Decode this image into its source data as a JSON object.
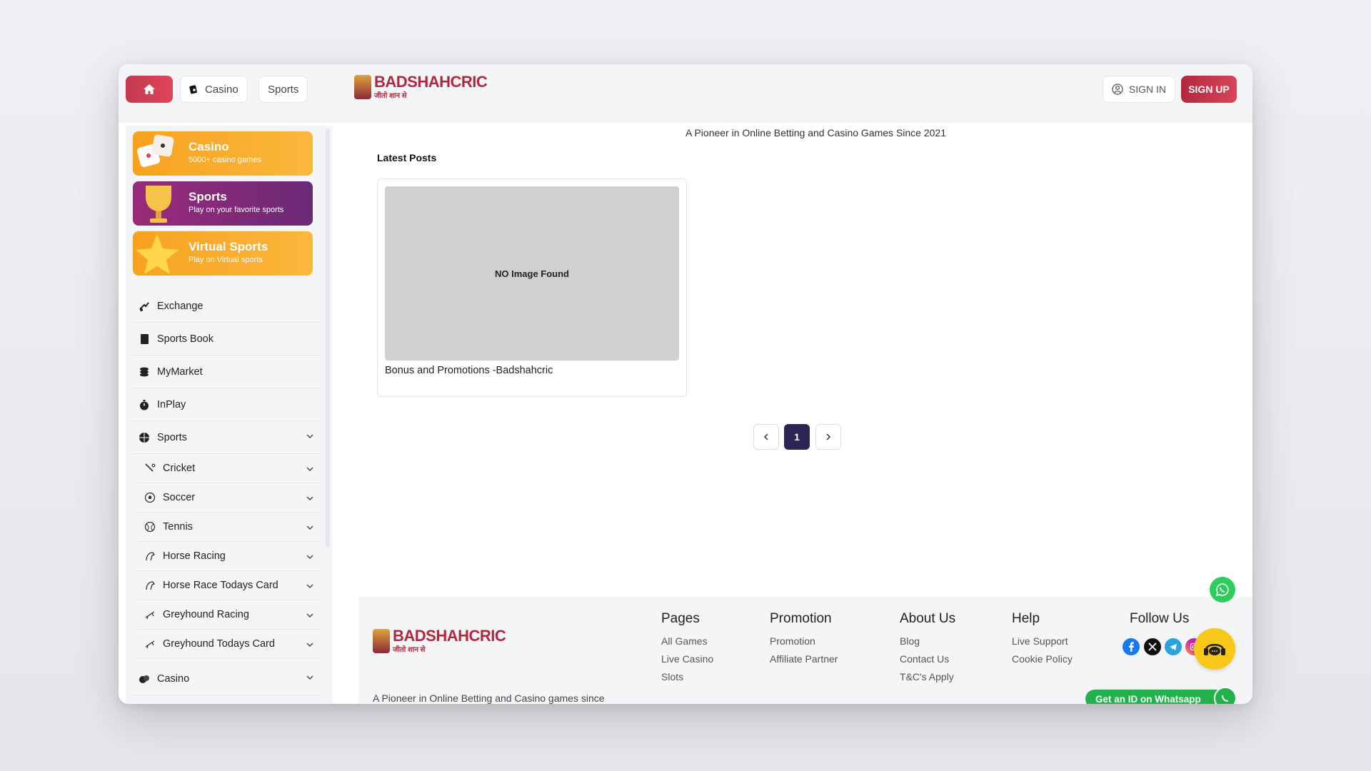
{
  "header": {
    "casino_label": "Casino",
    "sports_label": "Sports",
    "logo_text": "BADSHAHCRIC",
    "logo_tagline": "जीतो शान से",
    "signin_label": "SIGN IN",
    "signup_label": "SIGN UP",
    "accent": "#c8334a"
  },
  "sidebar": {
    "promos": [
      {
        "title": "Casino",
        "subtitle": "5000+ casino games",
        "color": "#f8a22a"
      },
      {
        "title": "Sports",
        "subtitle": "Play on your favorite sports",
        "color": "#8a2d78"
      },
      {
        "title": "Virtual Sports",
        "subtitle": "Play on Virtual sports",
        "color": "#f8a22a"
      }
    ],
    "items": [
      {
        "label": "Exchange",
        "icon": "exchange-icon"
      },
      {
        "label": "Sports Book",
        "icon": "book-icon"
      },
      {
        "label": "MyMarket",
        "icon": "coins-icon"
      },
      {
        "label": "InPlay",
        "icon": "stopwatch-icon"
      },
      {
        "label": "Sports",
        "icon": "sports-ball-icon"
      }
    ],
    "sub_items": [
      {
        "label": "Cricket",
        "icon": "cricket-bat-icon"
      },
      {
        "label": "Soccer",
        "icon": "soccer-ball-icon"
      },
      {
        "label": "Tennis",
        "icon": "tennis-ball-icon"
      },
      {
        "label": "Horse Racing",
        "icon": "horse-icon"
      },
      {
        "label": "Horse Race Todays Card",
        "icon": "horse-icon"
      },
      {
        "label": "Greyhound Racing",
        "icon": "greyhound-icon"
      },
      {
        "label": "Greyhound Todays Card",
        "icon": "greyhound-icon"
      }
    ],
    "casino_item": {
      "label": "Casino",
      "icon": "casino-chips-icon"
    }
  },
  "main": {
    "tagline": "A Pioneer in Online Betting and Casino Games Since 2021",
    "latest_heading": "Latest Posts",
    "post": {
      "image_placeholder": "NO Image Found",
      "title": "Bonus and Promotions -Badshahcric"
    },
    "pagination": {
      "current": "1"
    }
  },
  "footer": {
    "logo_text": "BADSHAHCRIC",
    "logo_tagline": "जीतो शान से",
    "description": "A Pioneer in Online Betting and Casino games since",
    "columns": [
      {
        "title": "Pages",
        "links": [
          "All Games",
          "Live Casino",
          "Slots"
        ]
      },
      {
        "title": "Promotion",
        "links": [
          "Promotion",
          "Affiliate Partner"
        ]
      },
      {
        "title": "About Us",
        "links": [
          "Blog",
          "Contact Us",
          "T&C's Apply"
        ]
      },
      {
        "title": "Help",
        "links": [
          "Live Support",
          "Cookie Policy"
        ]
      }
    ],
    "follow_title": "Follow Us",
    "social": [
      "facebook-icon",
      "x-icon",
      "telegram-icon",
      "instagram-icon"
    ],
    "whatsapp_cta": "Get an ID on Whatsapp"
  }
}
